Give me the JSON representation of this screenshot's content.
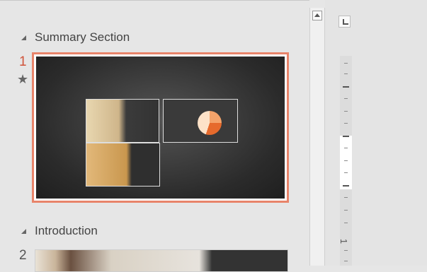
{
  "thumbnails_pane": {
    "sections": [
      {
        "label": "Summary Section"
      },
      {
        "label": "Introduction"
      }
    ],
    "slides": [
      {
        "number": "1",
        "selected": true,
        "starred": true
      },
      {
        "number": "2",
        "selected": false,
        "starred": false
      }
    ]
  },
  "vertical_ruler": {
    "label_1": "1"
  },
  "colors": {
    "selection_border": "#e8846a",
    "slide_number_selected": "#d0533a"
  },
  "icons": {
    "collapse_section": "collapse-triangle-icon",
    "star": "star-icon",
    "scroll_up": "arrow-up-icon",
    "tab_stop": "tab-stop-icon"
  }
}
